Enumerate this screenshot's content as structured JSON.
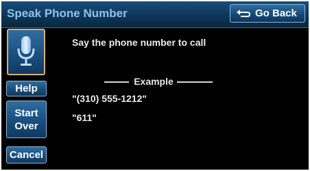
{
  "header": {
    "title": "Speak Phone Number",
    "back_label": "Go Back",
    "back_icon": "return-arrow-icon"
  },
  "sidebar": {
    "mic_icon": "microphone-icon",
    "help_label": "Help",
    "start_over_line1": "Start",
    "start_over_line2": "Over",
    "cancel_label": "Cancel"
  },
  "main": {
    "prompt": "Say the phone number to call",
    "example_label": "Example",
    "examples": [
      "\"(310) 555-1212\"",
      "\"611\""
    ]
  },
  "colors": {
    "accent_blue": "#194e7e",
    "title_text": "#8fc3ea",
    "mic_border": "#d6b07a"
  }
}
